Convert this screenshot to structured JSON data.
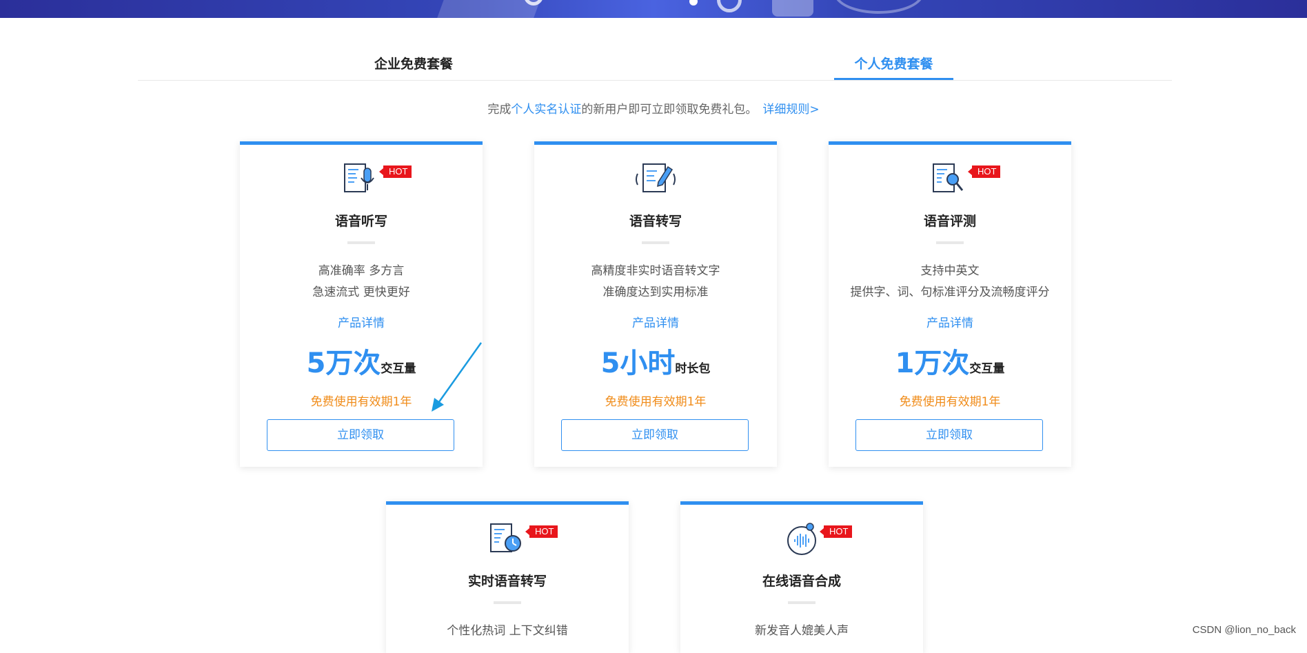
{
  "tabs": [
    {
      "label": "企业免费套餐",
      "active": false
    },
    {
      "label": "个人免费套餐",
      "active": true
    }
  ],
  "intro": {
    "prefix": "完成",
    "highlight": "个人实名认证",
    "suffix": "的新用户即可立即领取免费礼包。",
    "link": "详细规则>"
  },
  "hot_label": "HOT",
  "cards": [
    {
      "icon": "microphone-document-icon",
      "hot": true,
      "title": "语音听写",
      "desc_line1": "高准确率 多方言",
      "desc_line2": "急速流式 更快更好",
      "detail": "产品详情",
      "amount": "5万次",
      "unit": "交互量",
      "validity": "免费使用有效期1年",
      "button": "立即领取"
    },
    {
      "icon": "document-pen-icon",
      "hot": false,
      "title": "语音转写",
      "desc_line1": "高精度非实时语音转文字",
      "desc_line2": "准确度达到实用标准",
      "detail": "产品详情",
      "amount": "5小时",
      "unit": "时长包",
      "validity": "免费使用有效期1年",
      "button": "立即领取"
    },
    {
      "icon": "document-magnifier-icon",
      "hot": true,
      "title": "语音评测",
      "desc_line1": "支持中英文",
      "desc_line2": "提供字、词、句标准评分及流畅度评分",
      "detail": "产品详情",
      "amount": "1万次",
      "unit": "交互量",
      "validity": "免费使用有效期1年",
      "button": "立即领取"
    },
    {
      "icon": "document-clock-icon",
      "hot": true,
      "title": "实时语音转写",
      "desc_line1": "个性化热词 上下文纠错"
    },
    {
      "icon": "soundwave-circle-icon",
      "hot": true,
      "title": "在线语音合成",
      "desc_line1": "新发音人媲美人声"
    }
  ],
  "watermark": "CSDN @lion_no_back",
  "colors": {
    "accent": "#2f8ff0",
    "hot": "#e8161c",
    "validity": "#f08c1a",
    "annotation_arrow": "#1a9be0"
  }
}
